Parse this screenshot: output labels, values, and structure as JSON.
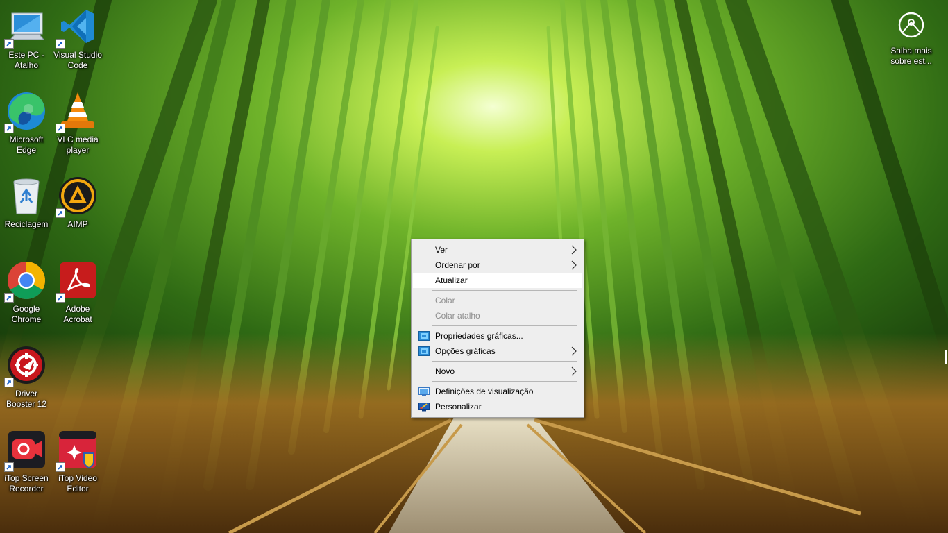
{
  "desktop": {
    "icons": [
      {
        "label": "Este PC - Atalho",
        "icon": "computer-icon"
      },
      {
        "label": "Visual Studio Code",
        "icon": "vscode-icon"
      },
      {
        "label": "Microsoft Edge",
        "icon": "edge-icon"
      },
      {
        "label": "VLC media player",
        "icon": "vlc-cone-icon"
      },
      {
        "label": "Reciclagem",
        "icon": "recycle-bin-icon"
      },
      {
        "label": "AIMP",
        "icon": "aimp-icon"
      },
      {
        "label": "Google Chrome",
        "icon": "chrome-icon"
      },
      {
        "label": "Adobe Acrobat",
        "icon": "acrobat-icon"
      },
      {
        "label": "Driver Booster 12",
        "icon": "driver-booster-icon"
      },
      {
        "label": "iTop Screen Recorder",
        "icon": "itop-screen-recorder-icon"
      },
      {
        "label": "iTop Video Editor",
        "icon": "itop-video-editor-icon"
      }
    ],
    "learn_more": {
      "label": "Saiba mais sobre est...",
      "icon": "camera-circle-icon"
    }
  },
  "context_menu": {
    "items": [
      {
        "label": "Ver",
        "submenu": true,
        "state": "normal"
      },
      {
        "label": "Ordenar por",
        "submenu": true,
        "state": "normal"
      },
      {
        "label": "Atualizar",
        "submenu": false,
        "state": "hover"
      },
      {
        "label": "Colar",
        "submenu": false,
        "state": "disabled"
      },
      {
        "label": "Colar atalho",
        "submenu": false,
        "state": "disabled"
      },
      {
        "label": "Propriedades gráficas...",
        "submenu": false,
        "state": "normal",
        "icon": "intel-graphics-icon"
      },
      {
        "label": "Opções gráficas",
        "submenu": true,
        "state": "normal",
        "icon": "intel-graphics-icon"
      },
      {
        "label": "Novo",
        "submenu": true,
        "state": "normal"
      },
      {
        "label": "Definições de visualização",
        "submenu": false,
        "state": "normal",
        "icon": "display-settings-icon"
      },
      {
        "label": "Personalizar",
        "submenu": false,
        "state": "normal",
        "icon": "personalize-icon"
      }
    ]
  },
  "colors": {
    "menu_bg": "#eeeeee",
    "menu_hover": "#ffffff",
    "menu_disabled_text": "#8d8d8d",
    "wallpaper_green": "#6fb32a",
    "wallpaper_path": "#c9b38f"
  }
}
